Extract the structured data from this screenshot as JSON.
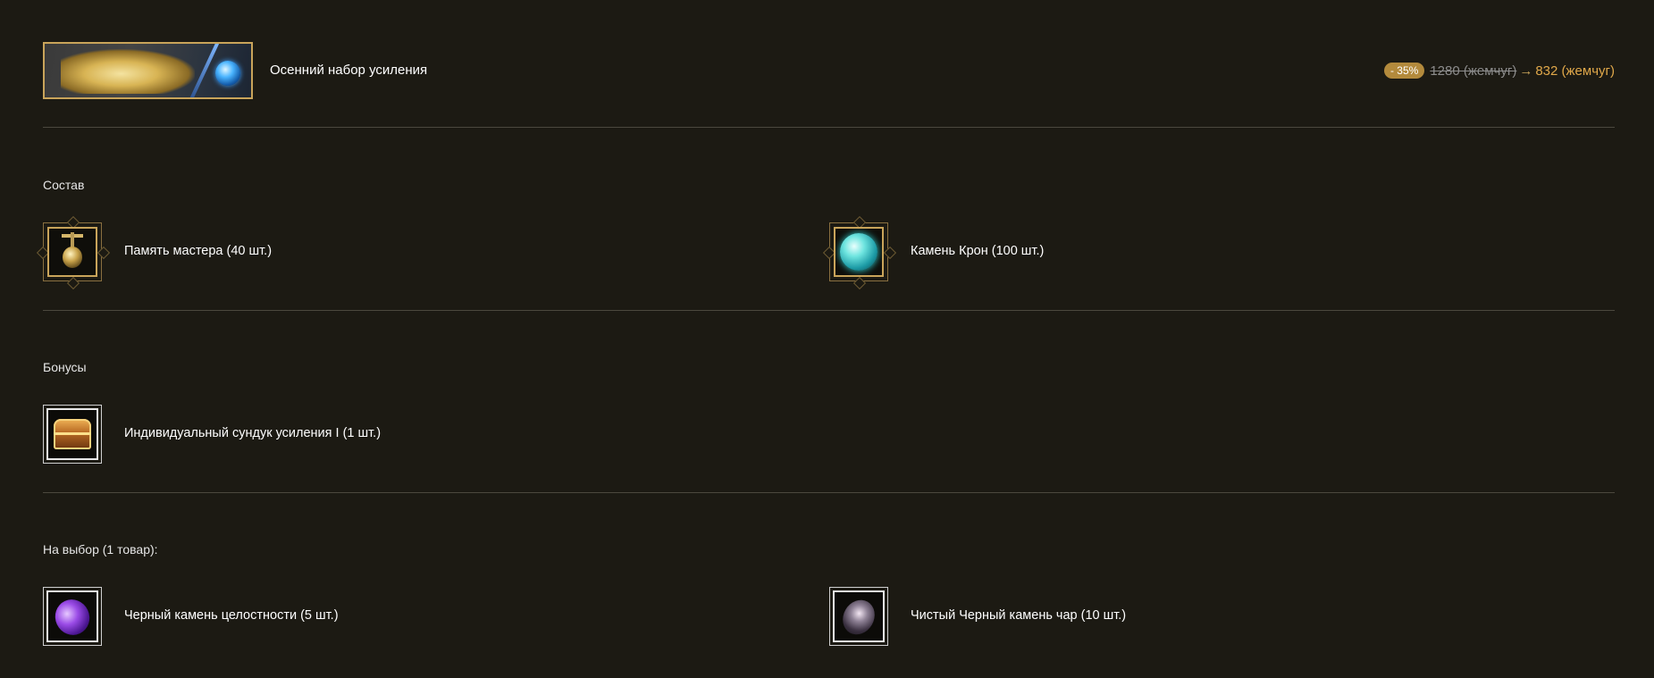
{
  "header": {
    "title": "Осенний набор усиления",
    "discount_badge": "- 35%",
    "old_price": "1280 (жемчуг)",
    "arrow": "→",
    "new_price": "832 (жемчуг)"
  },
  "composition": {
    "title": "Состав",
    "items": [
      {
        "label": "Память мастера (40 шт.)",
        "icon": "master-memory-icon"
      },
      {
        "label": "Камень Крон (100 шт.)",
        "icon": "cron-stone-icon"
      }
    ]
  },
  "bonuses": {
    "title": "Бонусы",
    "items": [
      {
        "label": "Индивидуальный сундук усиления I (1 шт.)",
        "icon": "enhancement-chest-icon"
      }
    ]
  },
  "choice": {
    "title": "На выбор (1 товар):",
    "items": [
      {
        "label": "Черный камень целостности (5 шт.)",
        "icon": "black-stone-integrity-icon"
      },
      {
        "label": "Чистый Черный камень чар (10 шт.)",
        "icon": "pure-black-stone-icon"
      }
    ]
  },
  "colors": {
    "background": "#1c1a13",
    "accent_gold": "#c9a45a",
    "price_new": "#e0a84a",
    "discount_badge": "#b38a3c"
  }
}
